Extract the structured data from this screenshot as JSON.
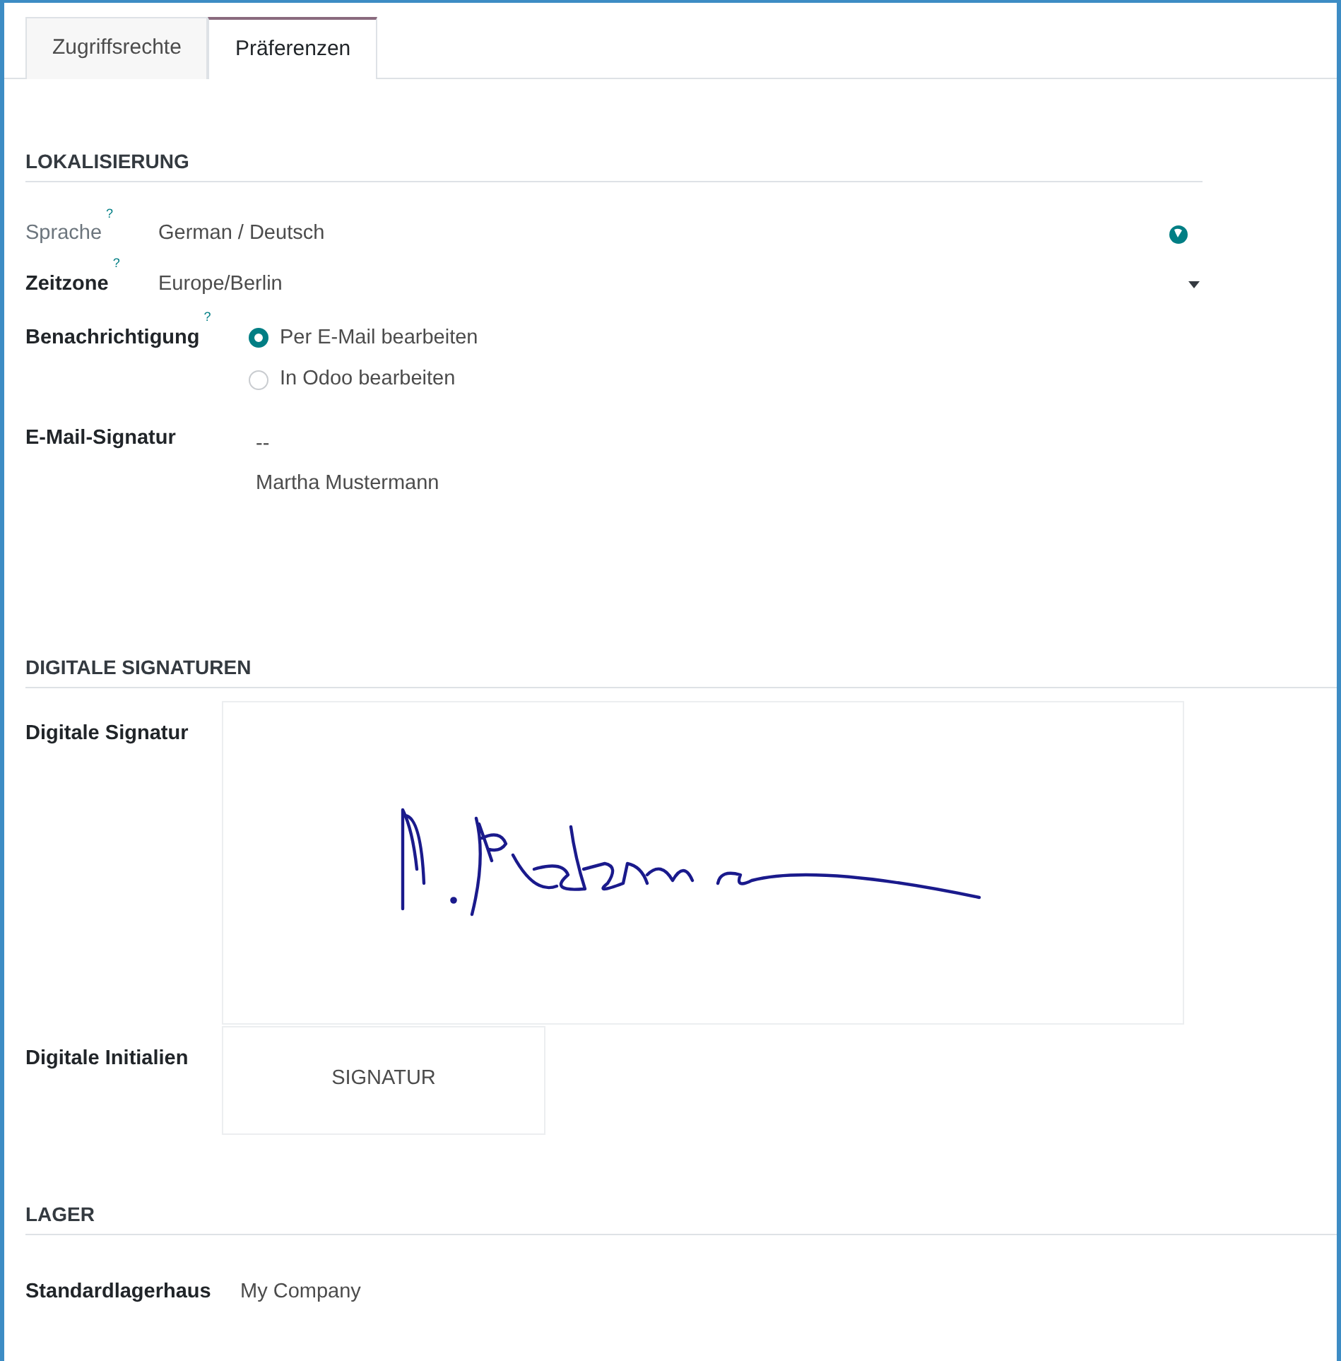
{
  "tabs": [
    {
      "label": "Zugriffsrechte",
      "selected": false
    },
    {
      "label": "Präferenzen",
      "selected": true
    }
  ],
  "sections": [
    {
      "title": "LOKALISIERUNG",
      "fields": [
        {
          "kind": "language",
          "label": "Sprache",
          "help": "?",
          "readonly": true,
          "value": "German / Deutsch"
        },
        {
          "kind": "select",
          "label": "Zeitzone",
          "help": "?",
          "readonly": false,
          "value": "Europe/Berlin"
        },
        {
          "kind": "radio",
          "label": "Benachrichtigung",
          "help": "?",
          "readonly": false,
          "options": [
            {
              "label": "Per E-Mail bearbeiten",
              "selected": true
            },
            {
              "label": "In Odoo bearbeiten",
              "selected": false
            }
          ]
        },
        {
          "kind": "text",
          "label": "E-Mail-Signatur",
          "readonly": false,
          "lines": [
            "--",
            "Martha Mustermann"
          ]
        }
      ]
    },
    {
      "title": "DIGITALE SIGNATUREN",
      "fields": [
        {
          "kind": "signature",
          "label": "Digitale Signatur",
          "readonly": false
        },
        {
          "kind": "initials",
          "label": "Digitale Initialien",
          "readonly": false,
          "value": "SIGNATUR"
        }
      ]
    },
    {
      "title": "LAGER",
      "fields": [
        {
          "kind": "plain",
          "label": "Standardlagerhaus",
          "readonly": false,
          "value": "My Company"
        }
      ]
    }
  ]
}
